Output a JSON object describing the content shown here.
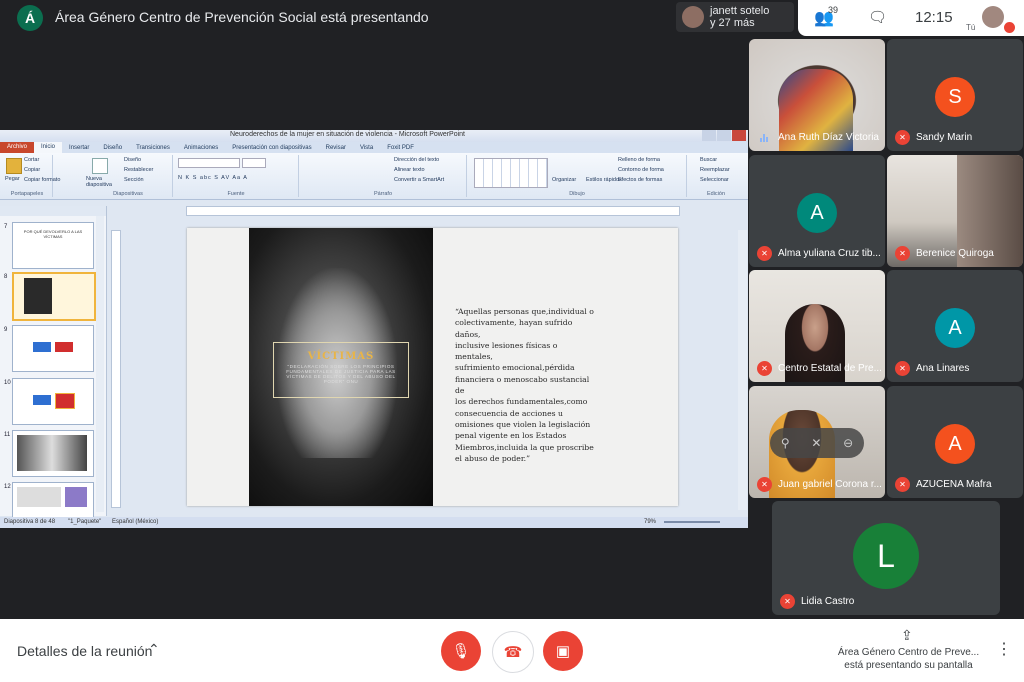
{
  "topbar": {
    "presenter_initial": "Á",
    "presenting_title": "Área Género Centro de Prevención Social está presentando",
    "participants_pill": {
      "line1": "janett sotelo",
      "line2": "y 27 más"
    },
    "people_count": "39",
    "clock": "12:15",
    "you_label": "Tú"
  },
  "ppt": {
    "window_title": "Neuroderechos de la mujer en situación de violencia - Microsoft PowerPoint",
    "tabs": [
      "Archivo",
      "Inicio",
      "Insertar",
      "Diseño",
      "Transiciones",
      "Animaciones",
      "Presentación con diapositivas",
      "Revisar",
      "Vista",
      "Foxit PDF"
    ],
    "ribbon": {
      "portapapeles": {
        "paste": "Pegar",
        "cut": "Cortar",
        "copy": "Copiar",
        "format": "Copiar formato",
        "label": "Portapapeles"
      },
      "diapositivas": {
        "new": "Nueva diapositiva",
        "layout": "Diseño",
        "reset": "Restablecer",
        "section": "Sección",
        "label": "Diapositivas"
      },
      "fuente": {
        "buttons": "N  K  S  abc  S  AV  Aa  A",
        "label": "Fuente"
      },
      "parrafo": {
        "direction": "Dirección del texto",
        "align": "Alinear texto",
        "smartart": "Convertir a SmartArt",
        "label": "Párrafo"
      },
      "dibujo": {
        "arrange": "Organizar",
        "styles": "Estilos rápidos",
        "fill": "Relleno de forma",
        "outline": "Contorno de forma",
        "effects": "Efectos de formas",
        "label": "Dibujo"
      },
      "edicion": {
        "find": "Buscar",
        "replace": "Reemplazar",
        "select": "Seleccionar",
        "label": "Edición"
      }
    },
    "thumbnails": [
      {
        "num": "7",
        "text": "POR QUÉ DEVOLVERLO A LAS VÍCTIMAS"
      },
      {
        "num": "8",
        "text": ""
      },
      {
        "num": "9",
        "text": ""
      },
      {
        "num": "10",
        "text": ""
      },
      {
        "num": "11",
        "text": ""
      },
      {
        "num": "12",
        "text": ""
      }
    ],
    "slide": {
      "victim_title": "VÍCTIMAS",
      "victim_sub": "\"DECLARACIÓN SOBRE LOS PRINCIPIOS FUNDAMENTALES DE JUSTICIA PARA LAS VÍCTIMAS DE DELITOS Y DEL ABUSO DEL PODER\" ONU",
      "quote": "“Aquellas personas que,individual o\ncolectivamente, hayan sufrido daños,\ninclusive lesiones físicas o mentales,\nsufrimiento emocional,pérdida\nfinanciera o menoscabo sustancial de\nlos derechos fundamentales,como\nconsecuencia de acciones u\nomisiones que violen la legislación\npenal vigente en los Estados\nMiembros,incluida la que proscribe\nel abuso de poder.”"
    },
    "status": {
      "slide_info": "Diapositiva 8 de 48",
      "theme": "\"1_Paquete\"",
      "language": "Español (México)",
      "zoom": "79%"
    }
  },
  "participants": [
    {
      "name": "Ana Ruth Díaz Victoria",
      "initial": "",
      "color": "",
      "speaking": true
    },
    {
      "name": "Sandy Marin",
      "initial": "S",
      "color": "#f4511e",
      "speaking": false
    },
    {
      "name": "Alma yuliana Cruz tib...",
      "initial": "A",
      "color": "#00897b",
      "speaking": false
    },
    {
      "name": "Berenice Quiroga",
      "initial": "",
      "color": "",
      "speaking": false
    },
    {
      "name": "Centro Estatal de Pre...",
      "initial": "",
      "color": "",
      "speaking": false
    },
    {
      "name": "Ana Linares",
      "initial": "A",
      "color": "#0097a7",
      "speaking": false
    },
    {
      "name": "Juan gabriel Corona r...",
      "initial": "",
      "color": "",
      "speaking": false
    },
    {
      "name": "AZUCENA Mafra",
      "initial": "A",
      "color": "#f4511e",
      "speaking": false
    },
    {
      "name": "Lidia Castro",
      "initial": "L",
      "color": "#188038",
      "speaking": false
    }
  ],
  "bottombar": {
    "details": "Detalles de la reunión",
    "present_line1": "Área Género Centro de Preve...",
    "present_line2": "está presentando su pantalla"
  },
  "colors": {
    "danger": "#ea4335",
    "bg": "#202124",
    "tile": "#3c4043"
  }
}
